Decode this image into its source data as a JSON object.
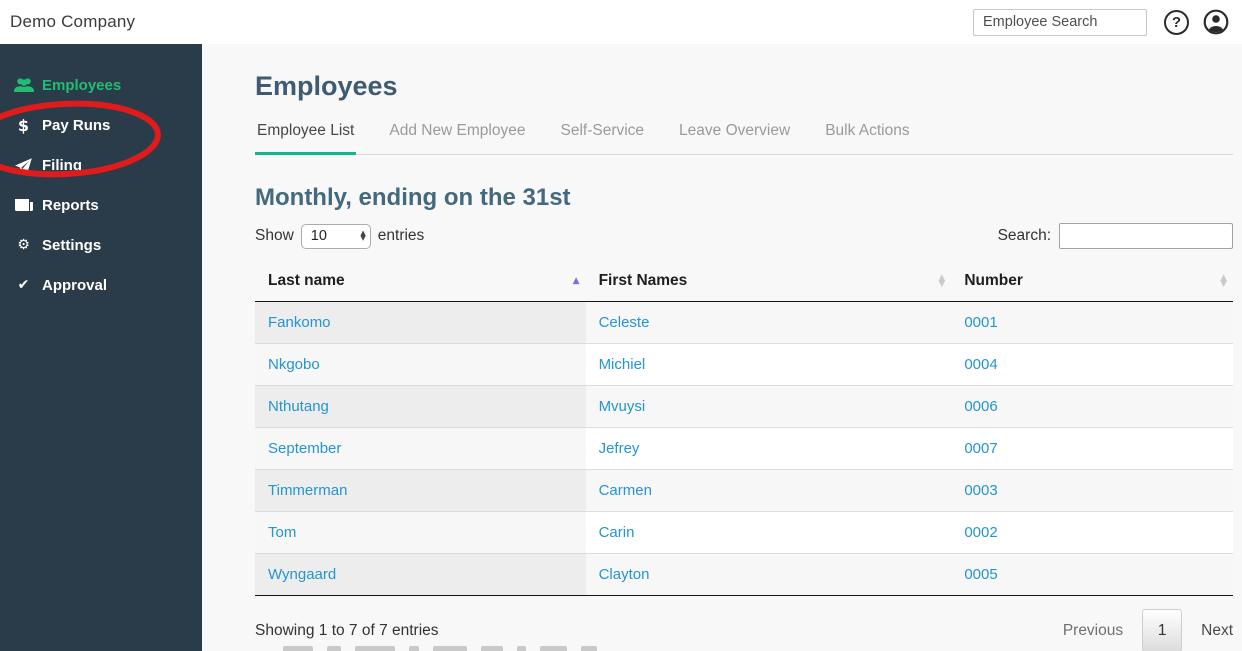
{
  "topbar": {
    "company_name": "Demo Company",
    "search_placeholder": "Employee Search"
  },
  "sidebar": {
    "items": [
      {
        "label": "Employees",
        "icon": "users",
        "active": true
      },
      {
        "label": "Pay Runs",
        "icon": "dollar",
        "active": false
      },
      {
        "label": "Filing",
        "icon": "paper-plane",
        "active": false
      },
      {
        "label": "Reports",
        "icon": "newspaper",
        "active": false
      },
      {
        "label": "Settings",
        "icon": "gear",
        "active": false
      },
      {
        "label": "Approval",
        "icon": "check",
        "active": false
      }
    ]
  },
  "annotation": {
    "shape": "ellipse",
    "color": "#e01b1b",
    "circled_items": [
      "Pay Runs",
      "Filing"
    ]
  },
  "main": {
    "title": "Employees",
    "tabs": [
      {
        "label": "Employee List",
        "active": true
      },
      {
        "label": "Add New Employee",
        "active": false
      },
      {
        "label": "Self-Service",
        "active": false
      },
      {
        "label": "Leave Overview",
        "active": false
      },
      {
        "label": "Bulk Actions",
        "active": false
      }
    ],
    "section_title": "Monthly, ending on the 31st",
    "show_entries": {
      "prefix": "Show",
      "value": "10",
      "suffix": "entries"
    },
    "search_label": "Search:",
    "table": {
      "columns": [
        "Last name",
        "First Names",
        "Number"
      ],
      "sort": {
        "column": "Last name",
        "direction": "asc"
      },
      "rows": [
        [
          "Fankomo",
          "Celeste",
          "0001"
        ],
        [
          "Nkgobo",
          "Michiel",
          "0004"
        ],
        [
          "Nthutang",
          "Mvuysi",
          "0006"
        ],
        [
          "September",
          "Jefrey",
          "0007"
        ],
        [
          "Timmerman",
          "Carmen",
          "0003"
        ],
        [
          "Tom",
          "Carin",
          "0002"
        ],
        [
          "Wyngaard",
          "Clayton",
          "0005"
        ]
      ]
    },
    "footer": {
      "info": "Showing 1 to 7 of 7 entries",
      "pagination": {
        "previous": "Previous",
        "current_page": "1",
        "next": "Next"
      }
    }
  },
  "colors": {
    "sidebar_bg": "#2a3b49",
    "active_green": "#23bd71",
    "tab_underline_green": "#15b589",
    "link_blue": "#2395d0",
    "heading_blue": "#3e5b71",
    "section_heading": "#44697d",
    "annotation_red": "#e01b1b",
    "sort_arrow_purple": "#7a6fd8"
  }
}
